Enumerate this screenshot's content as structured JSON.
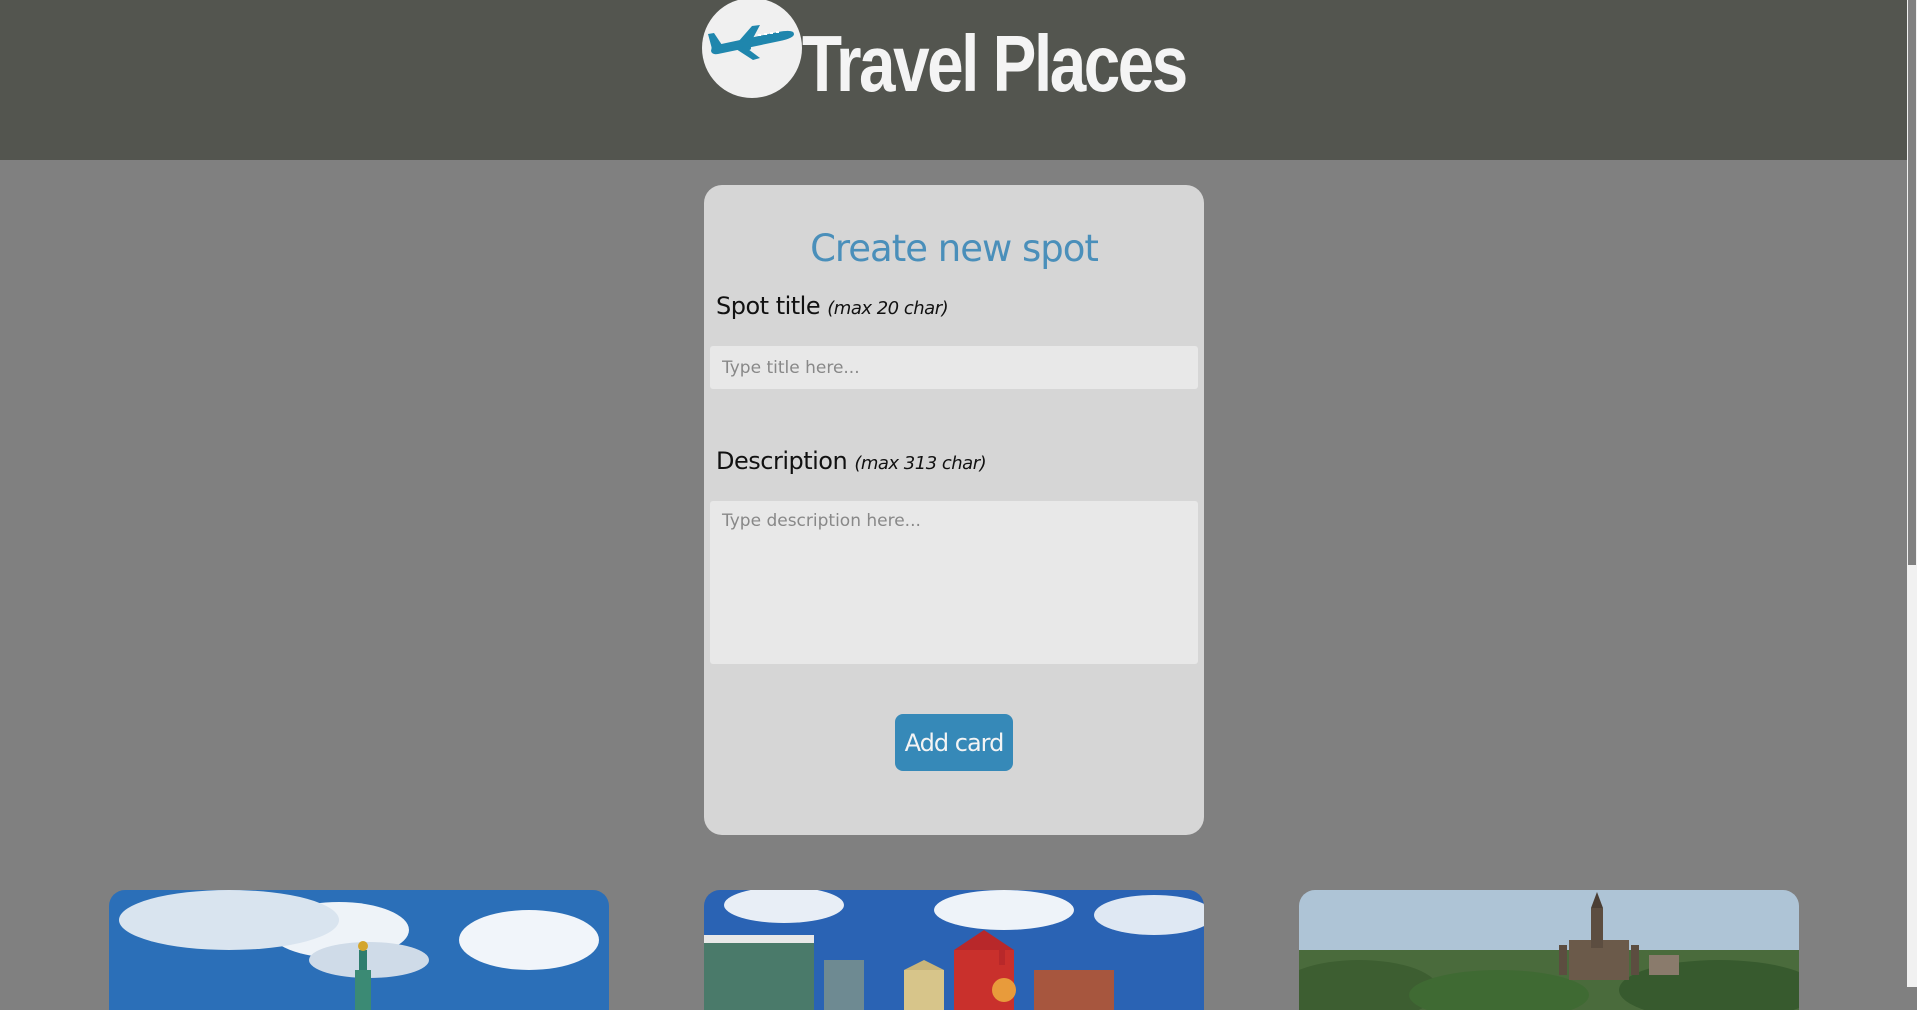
{
  "header": {
    "logo_icon": "airplane-icon",
    "brand": "Travel Places",
    "background": "#53554f"
  },
  "form": {
    "title": "Create new spot",
    "spot_title_label": "Spot title",
    "spot_title_hint": "(max 20 char)",
    "spot_title_placeholder": "Type title here...",
    "spot_title_value": "",
    "description_label": "Description",
    "description_hint": "(max 313 char)",
    "description_placeholder": "Type description here...",
    "description_value": "",
    "submit_label": "Add card",
    "accent": "#3689b8"
  },
  "cards": [
    {
      "image": "city-tower-sky"
    },
    {
      "image": "colorful-buildings-sky"
    },
    {
      "image": "castle-over-trees"
    }
  ]
}
